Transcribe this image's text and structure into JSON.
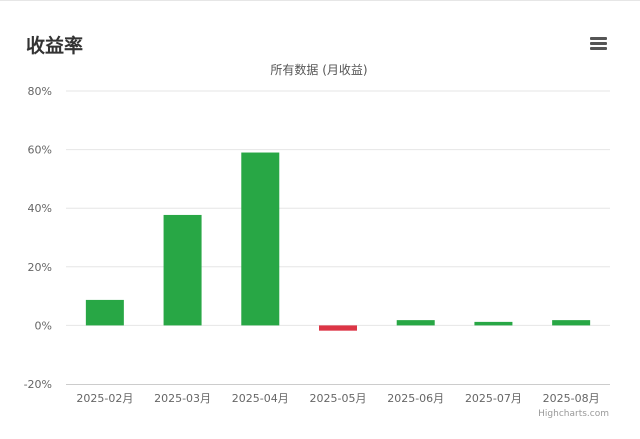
{
  "page": {
    "title": "收益率"
  },
  "menu": {
    "icon": "hamburger-icon"
  },
  "chart_data": {
    "type": "bar",
    "subtitle": "所有数据 (月收益)",
    "categories": [
      "2025-02月",
      "2025-03月",
      "2025-04月",
      "2025-05月",
      "2025-06月",
      "2025-07月",
      "2025-08月"
    ],
    "values": [
      8.7,
      37.7,
      59.0,
      -1.8,
      1.8,
      1.2,
      1.8
    ],
    "ylim": [
      -20,
      80
    ],
    "yticks": [
      -20,
      0,
      20,
      40,
      60,
      80
    ],
    "ytick_labels": [
      "-20%",
      "0%",
      "20%",
      "40%",
      "60%",
      "80%"
    ],
    "grid": true,
    "colors": {
      "positive": "#28a745",
      "negative": "#dc3545",
      "grid": "#e6e6e6",
      "axis": "#cccccc",
      "label": "#666666"
    },
    "credits": "Highcharts.com"
  }
}
